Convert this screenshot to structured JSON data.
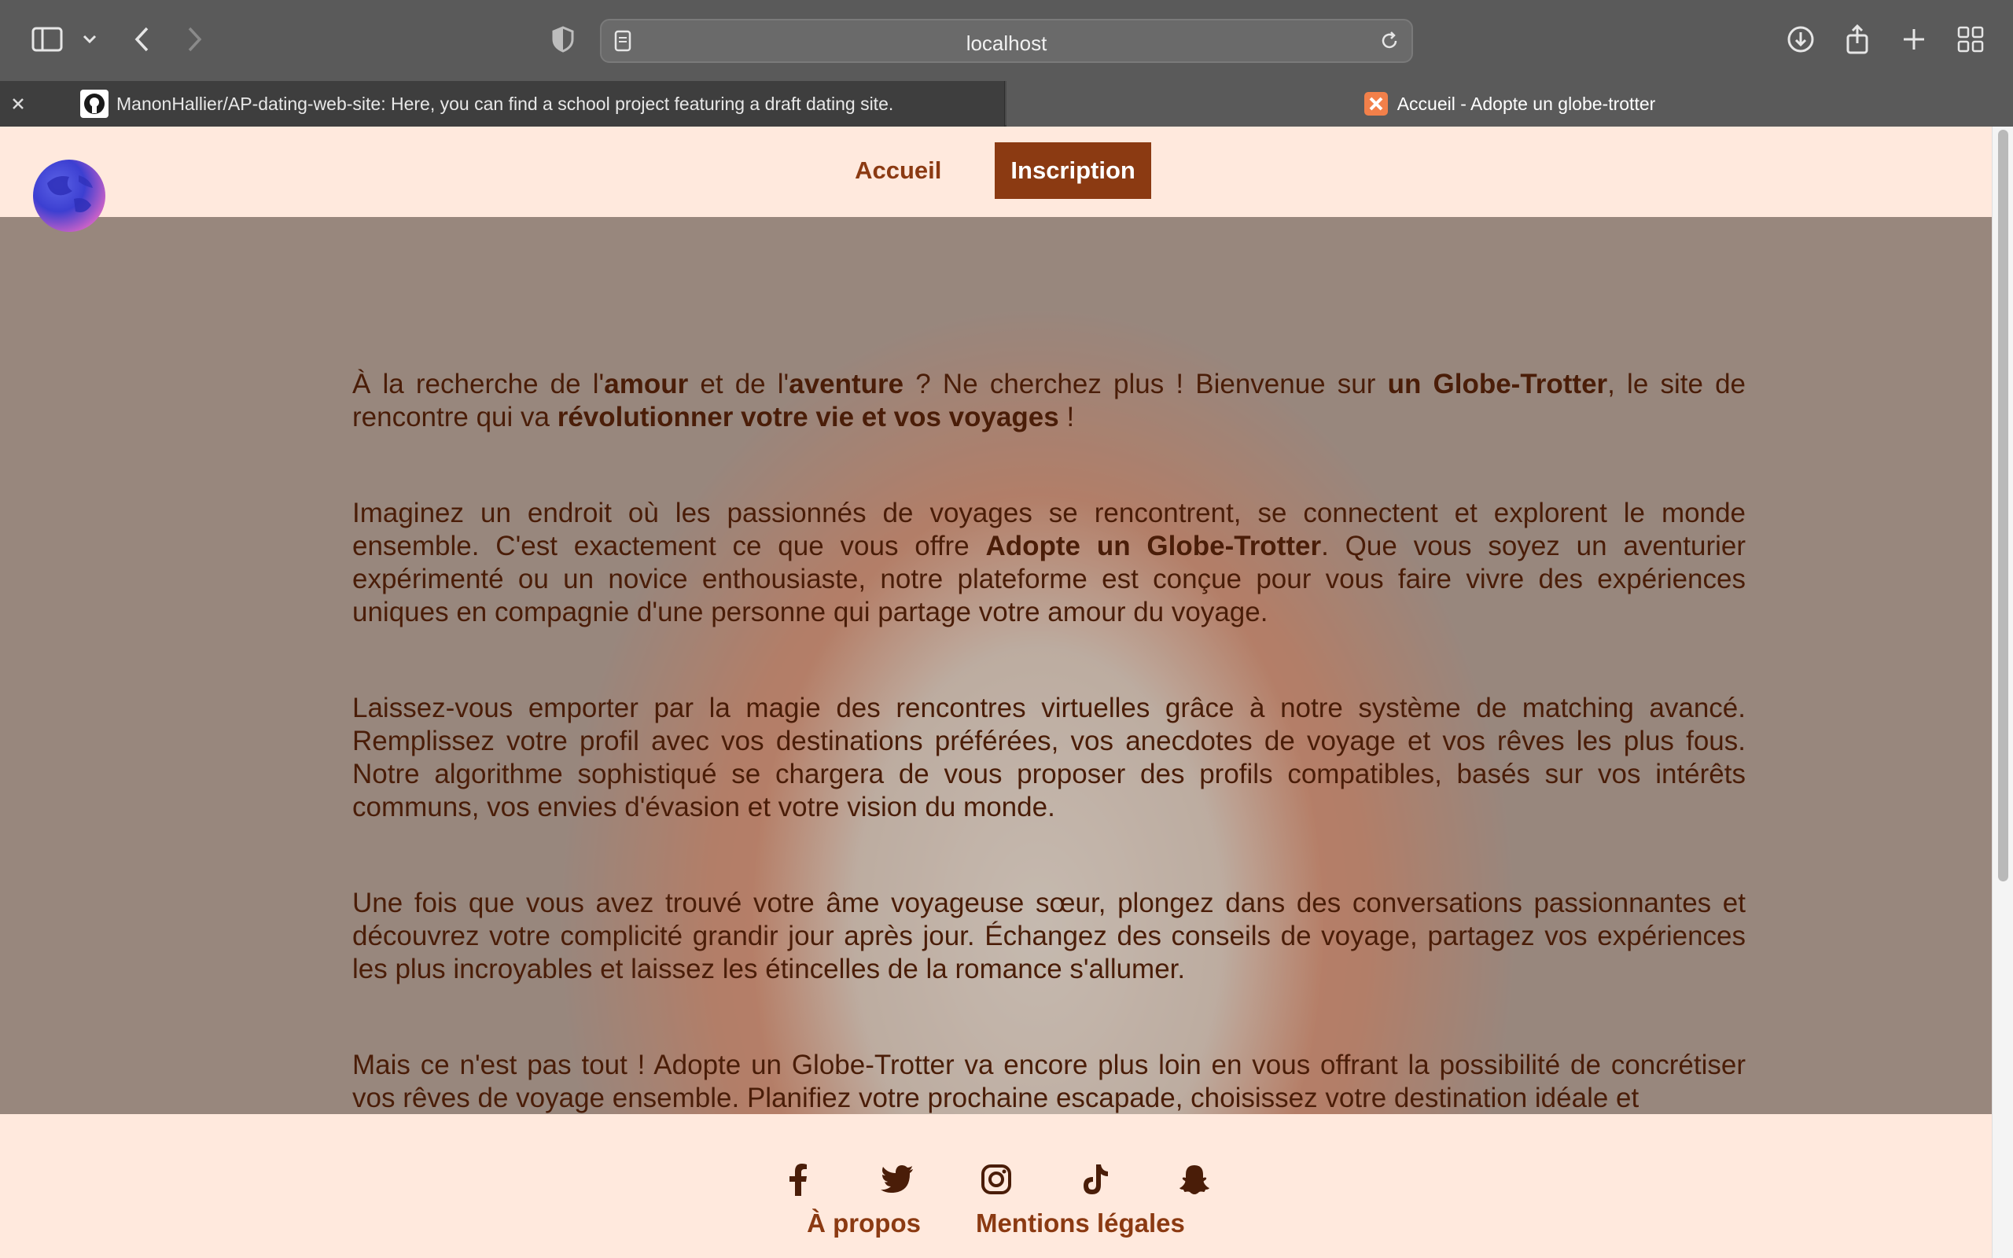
{
  "browser": {
    "address": "localhost",
    "tabs": [
      {
        "label": "ManonHallier/AP-dating-web-site: Here, you can find a school project featuring a draft dating site.",
        "active": false
      },
      {
        "label": "Accueil - Adopte un globe-trotter",
        "active": true
      }
    ]
  },
  "site": {
    "nav": {
      "home": "Accueil",
      "signup": "Inscription"
    },
    "paragraphs": {
      "p1": {
        "a": "À la recherche de l'",
        "b": "amour",
        "c": " et de l'",
        "d": "aventure",
        "e": " ? Ne cherchez plus ! Bienvenue sur ",
        "f": "un Globe-Trotter",
        "g": ", le site de rencontre qui va ",
        "h": "révolutionner votre vie et vos voyages",
        "i": " !"
      },
      "p2": {
        "a": "Imaginez un endroit où les passionnés de voyages se rencontrent, se connectent et explorent le monde ensemble. C'est exactement ce que vous offre ",
        "b": "Adopte un Globe-Trotter",
        "c": ". Que vous soyez un aventurier expérimenté ou un novice enthousiaste, notre plateforme est conçue pour vous faire vivre des expériences uniques en compagnie d'une personne qui partage votre amour du voyage."
      },
      "p3": "Laissez-vous emporter par la magie des rencontres virtuelles grâce à notre système de matching avancé. Remplissez votre profil avec vos destinations préférées, vos anecdotes de voyage et vos rêves les plus fous. Notre algorithme sophistiqué se chargera de vous proposer des profils compatibles, basés sur vos intérêts communs, vos envies d'évasion et votre vision du monde.",
      "p4": "Une fois que vous avez trouvé votre âme voyageuse sœur, plongez dans des conversations passionnantes et découvrez votre complicité grandir jour après jour. Échangez des conseils de voyage, partagez vos expériences les plus incroyables et laissez les étincelles de la romance s'allumer.",
      "p5": "Mais ce n'est pas tout ! Adopte un Globe-Trotter va encore plus loin en vous offrant la possibilité de concrétiser vos rêves de voyage ensemble. Planifiez votre prochaine escapade, choisissez votre destination idéale et"
    },
    "footer": {
      "social": [
        "facebook-icon",
        "twitter-icon",
        "instagram-icon",
        "tiktok-icon",
        "snapchat-icon"
      ],
      "about": "À propos",
      "legal": "Mentions légales"
    },
    "colors": {
      "accent": "#8b3a12",
      "background": "#ffe9dd",
      "text": "#4a1d08"
    }
  }
}
